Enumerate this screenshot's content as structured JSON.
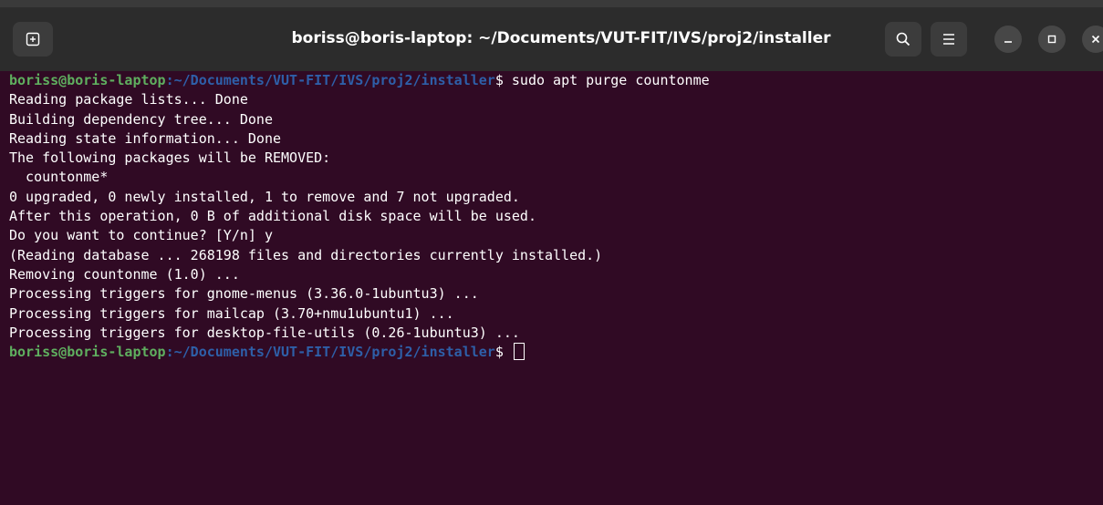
{
  "window": {
    "title": "boriss@boris-laptop: ~/Documents/VUT-FIT/IVS/proj2/installer",
    "buttons": [
      "new-tab",
      "search",
      "menu",
      "minimize",
      "maximize",
      "close"
    ]
  },
  "colors": {
    "background": "#300a24",
    "titlebar": "#2c2c2c",
    "prompt_user": "#5faf5f",
    "prompt_path": "#2e5fa8",
    "text": "#ffffff"
  },
  "terminal": {
    "prompt1": {
      "user_host": "boriss@boris-laptop",
      "colon": ":",
      "path": "~/Documents/VUT-FIT/IVS/proj2/installer",
      "dollar": "$",
      "command": " sudo apt purge countonme"
    },
    "output": [
      "Reading package lists... Done",
      "Building dependency tree... Done",
      "Reading state information... Done",
      "The following packages will be REMOVED:",
      "  countonme*",
      "0 upgraded, 0 newly installed, 1 to remove and 7 not upgraded.",
      "After this operation, 0 B of additional disk space will be used.",
      "Do you want to continue? [Y/n] y",
      "(Reading database ... 268198 files and directories currently installed.)",
      "Removing countonme (1.0) ...",
      "Processing triggers for gnome-menus (3.36.0-1ubuntu3) ...",
      "Processing triggers for mailcap (3.70+nmu1ubuntu1) ...",
      "Processing triggers for desktop-file-utils (0.26-1ubuntu3) ..."
    ],
    "prompt2": {
      "user_host": "boriss@boris-laptop",
      "colon": ":",
      "path": "~/Documents/VUT-FIT/IVS/proj2/installer",
      "dollar": "$",
      "command": " "
    }
  }
}
